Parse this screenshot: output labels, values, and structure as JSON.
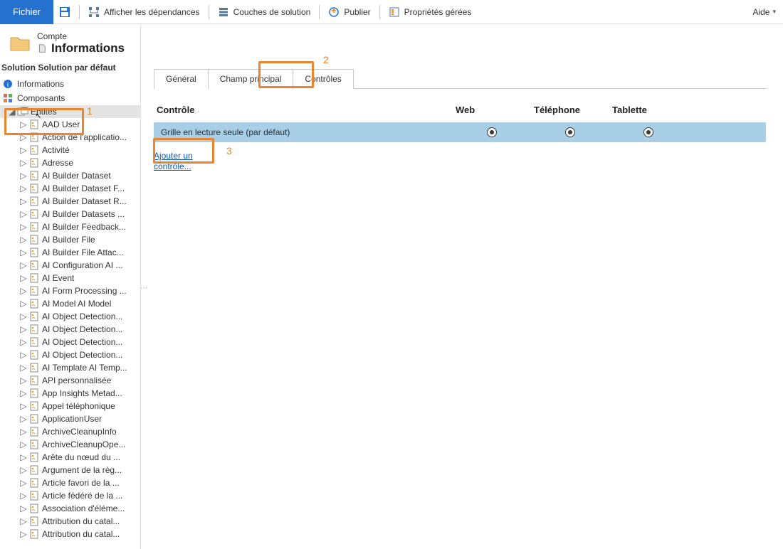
{
  "toolbar": {
    "file_label": "Fichier",
    "deps_label": "Afficher les dépendances",
    "layers_label": "Couches de solution",
    "publish_label": "Publier",
    "managed_label": "Propriétés gérées",
    "help_label": "Aide"
  },
  "header": {
    "small": "Compte",
    "big": "Informations"
  },
  "solution_title": "Solution Solution par défaut",
  "nav_info": "Informations",
  "nav_comp": "Composants",
  "entities_label": "Entités",
  "tree": [
    "AAD User",
    "Action de l'applicatio...",
    "Activité",
    "Adresse",
    "AI Builder Dataset",
    "AI Builder Dataset F...",
    "AI Builder Dataset R...",
    "AI Builder Datasets ...",
    "AI Builder Feedback...",
    "AI Builder File",
    "AI Builder File Attac...",
    "AI Configuration AI ...",
    "AI Event",
    "AI Form Processing ...",
    "AI Model AI Model",
    "AI Object Detection...",
    "AI Object Detection...",
    "AI Object Detection...",
    "AI Object Detection...",
    "AI Template AI Temp...",
    "API personnalisée",
    "App Insights Metad...",
    "Appel téléphonique",
    "ApplicationUser",
    "ArchiveCleanupInfo",
    "ArchiveCleanupOpe...",
    "Arête du nœud du ...",
    "Argument de la règ...",
    "Article favori de la ...",
    "Article fédéré de la ...",
    "Association d'éléme...",
    "Attribution du catal...",
    "Attribution du catal..."
  ],
  "tabs": {
    "general": "Général",
    "primary": "Champ principal",
    "controls": "Contrôles"
  },
  "table": {
    "cols": {
      "control": "Contrôle",
      "web": "Web",
      "phone": "Téléphone",
      "tablet": "Tablette"
    },
    "row": {
      "label": "Grille en lecture seule (par défaut)"
    }
  },
  "add_control": "Ajouter un contrôle...",
  "callouts": {
    "one": "1",
    "two": "2",
    "three": "3"
  }
}
